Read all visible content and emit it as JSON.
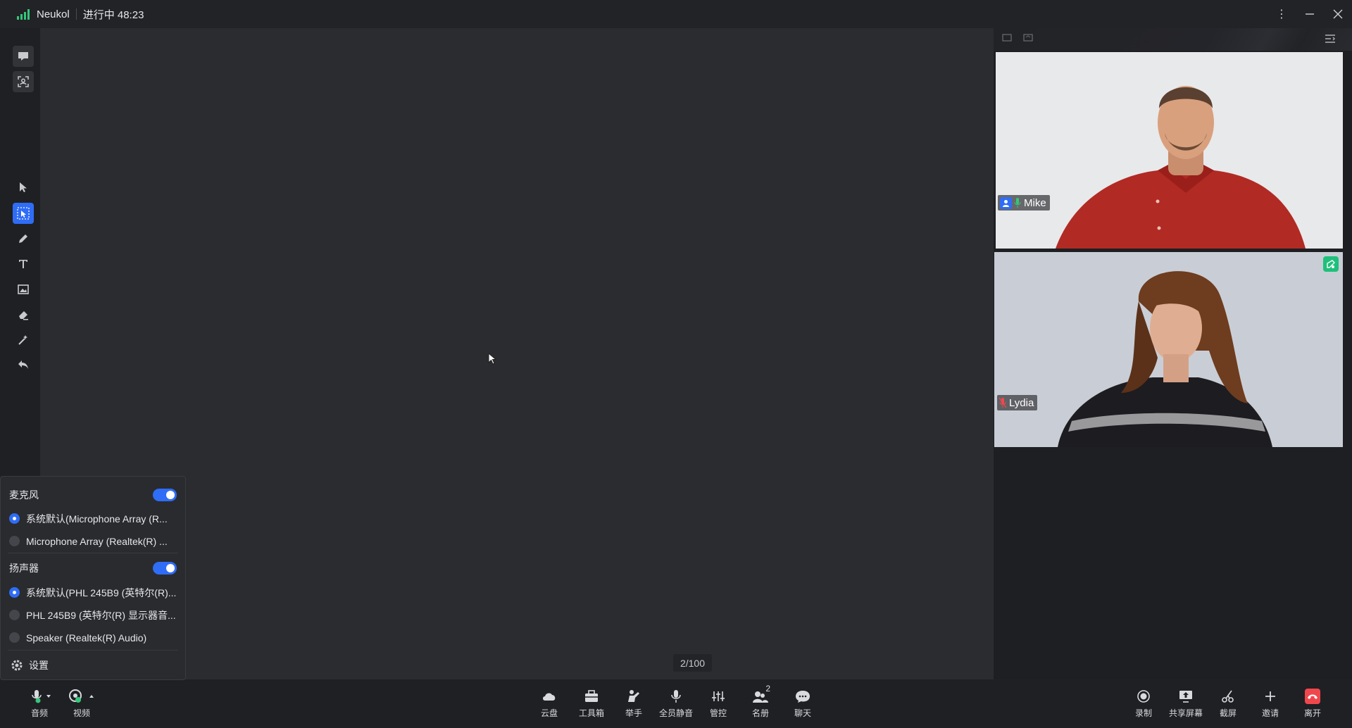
{
  "titlebar": {
    "app_name": "Neukol",
    "status": "进行中 48:23",
    "signal_icon": "signal-icon",
    "accent": "#34c77b"
  },
  "window_controls": {
    "more": "more-icon",
    "minimize": "minimize-icon",
    "close": "close-icon"
  },
  "left_tools": [
    "chat-bubble-icon",
    "face-frame-icon",
    "pointer-icon",
    "select-icon",
    "pen-icon",
    "text-icon",
    "image-icon",
    "eraser-icon",
    "magic-wand-icon",
    "undo-icon"
  ],
  "stage": {
    "page_counter": "2/100"
  },
  "participants": [
    {
      "name": "Mike",
      "mic": "on"
    },
    {
      "name": "Lydia",
      "mic": "muted"
    }
  ],
  "audio_popup": {
    "mic_section": "麦克风",
    "mic_options": [
      "系统默认(Microphone Array (R...",
      "Microphone Array (Realtek(R) ..."
    ],
    "speaker_section": "扬声器",
    "speaker_options": [
      "系统默认(PHL 245B9 (英特尔(R)...",
      "PHL 245B9 (英特尔(R) 显示器音...",
      "Speaker (Realtek(R) Audio)"
    ],
    "settings_label": "设置"
  },
  "bottom_left": {
    "audio": "音频",
    "video": "视频"
  },
  "bottom_center": {
    "cloud": "云盘",
    "toolbox": "工具箱",
    "raise_hand": "举手",
    "mute_all": "全员静音",
    "manage": "管控",
    "roster": "名册",
    "roster_count": "2",
    "chat": "聊天"
  },
  "bottom_right": {
    "record": "录制",
    "share_screen": "共享屏幕",
    "screenshot": "截屏",
    "invite": "邀请",
    "leave": "离开",
    "leave_color": "#f0474d"
  }
}
